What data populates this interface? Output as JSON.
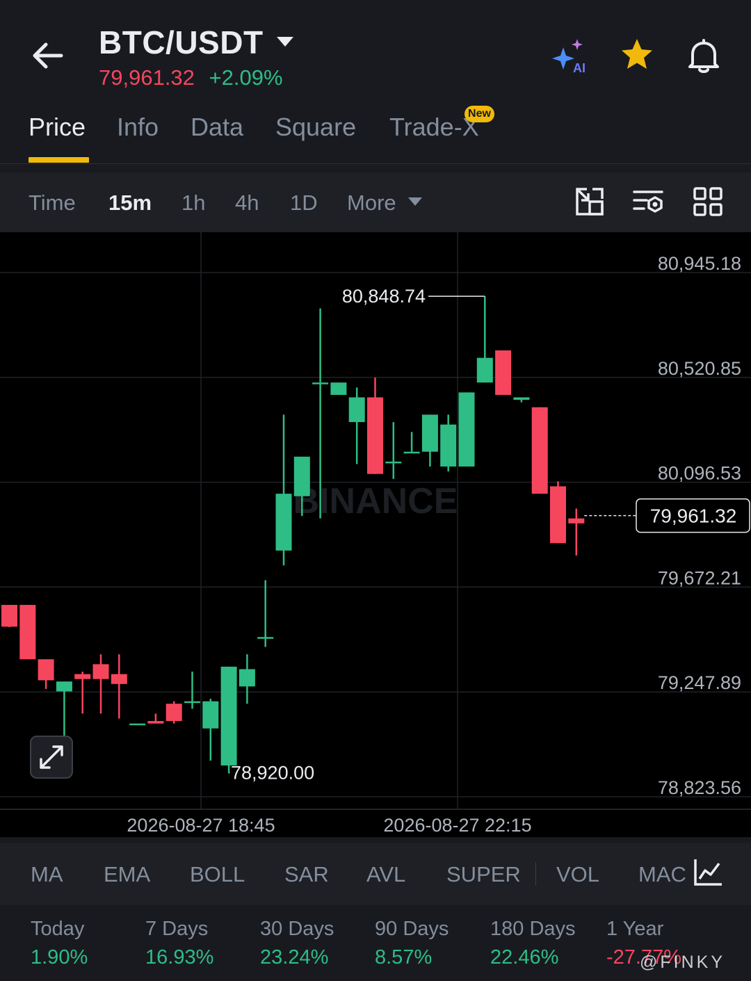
{
  "header": {
    "pair": "BTC/USDT",
    "last_price": "79,961.32",
    "change_pct": "+2.09%",
    "ai_label": "AI",
    "colors": {
      "up": "#2ebd85",
      "down": "#f6465d",
      "accent": "#f0b90b"
    }
  },
  "tabs": [
    {
      "label": "Price",
      "active": true
    },
    {
      "label": "Info",
      "active": false
    },
    {
      "label": "Data",
      "active": false
    },
    {
      "label": "Square",
      "active": false
    },
    {
      "label": "Trade-X",
      "active": false,
      "badge": "New"
    }
  ],
  "intervals": {
    "items": [
      "Time",
      "15m",
      "1h",
      "4h",
      "1D",
      "More"
    ],
    "active": "15m"
  },
  "chart_data": {
    "type": "candlestick",
    "interval": "15m",
    "watermark": "BINANCE",
    "y_ticks": [
      "80,945.18",
      "80,520.85",
      "80,096.53",
      "79,672.21",
      "79,247.89",
      "78,823.56"
    ],
    "x_ticks": [
      "2026-08-27 18:45",
      "2026-08-27 22:15"
    ],
    "current_price_label": "79,961.32",
    "high_label": "80,848.74",
    "low_label": "78,920.00",
    "candles": [
      {
        "o": 79600,
        "h": 79600,
        "l": 79510,
        "c": 79512
      },
      {
        "o": 79600,
        "h": 79600,
        "l": 79380,
        "c": 79380
      },
      {
        "o": 79380,
        "h": 79380,
        "l": 79260,
        "c": 79295
      },
      {
        "o": 79250,
        "h": 79290,
        "l": 79000,
        "c": 79290
      },
      {
        "o": 79320,
        "h": 79330,
        "l": 79160,
        "c": 79300
      },
      {
        "o": 79360,
        "h": 79400,
        "l": 79160,
        "c": 79300
      },
      {
        "o": 79320,
        "h": 79400,
        "l": 79140,
        "c": 79280
      },
      {
        "o": 79120,
        "h": 79120,
        "l": 79120,
        "c": 79120
      },
      {
        "o": 79130,
        "h": 79160,
        "l": 79120,
        "c": 79120
      },
      {
        "o": 79200,
        "h": 79210,
        "l": 79120,
        "c": 79130
      },
      {
        "o": 79210,
        "h": 79330,
        "l": 79180,
        "c": 79210
      },
      {
        "o": 79100,
        "h": 79220,
        "l": 78970,
        "c": 79210
      },
      {
        "o": 78950,
        "h": 79350,
        "l": 78920,
        "c": 79350
      },
      {
        "o": 79270,
        "h": 79400,
        "l": 79200,
        "c": 79340
      },
      {
        "o": 79470,
        "h": 79700,
        "l": 79430,
        "c": 79470
      },
      {
        "o": 79820,
        "h": 80370,
        "l": 79760,
        "c": 80050
      },
      {
        "o": 80040,
        "h": 80200,
        "l": 79960,
        "c": 80200
      },
      {
        "o": 80500,
        "h": 80800,
        "l": 79950,
        "c": 80500
      },
      {
        "o": 80450,
        "h": 80380,
        "l": 80490,
        "c": 80500
      },
      {
        "o": 80340,
        "h": 80480,
        "l": 80170,
        "c": 80440
      },
      {
        "o": 80440,
        "h": 80520,
        "l": 80230,
        "c": 80130
      },
      {
        "o": 80180,
        "h": 80340,
        "l": 80110,
        "c": 80180
      },
      {
        "o": 80220,
        "h": 80300,
        "l": 80220,
        "c": 80220
      },
      {
        "o": 80220,
        "h": 80330,
        "l": 80160,
        "c": 80370
      },
      {
        "o": 80160,
        "h": 80370,
        "l": 80140,
        "c": 80330
      },
      {
        "o": 80160,
        "h": 80370,
        "l": 80200,
        "c": 80460
      },
      {
        "o": 80500,
        "h": 80849,
        "l": 80500,
        "c": 80600
      },
      {
        "o": 80630,
        "h": 80630,
        "l": 80550,
        "c": 80450
      },
      {
        "o": 80430,
        "h": 80400,
        "l": 80420,
        "c": 80440
      },
      {
        "o": 80400,
        "h": 80400,
        "l": 80120,
        "c": 80050
      },
      {
        "o": 80080,
        "h": 80100,
        "l": 79950,
        "c": 79850
      },
      {
        "o": 79950,
        "h": 79990,
        "l": 79800,
        "c": 79930
      }
    ]
  },
  "indicators": [
    "MA",
    "EMA",
    "BOLL",
    "SAR",
    "AVL",
    "SUPER",
    "VOL",
    "MAC"
  ],
  "performance": [
    {
      "label": "Today",
      "value": "1.90%",
      "dir": "up"
    },
    {
      "label": "7 Days",
      "value": "16.93%",
      "dir": "up"
    },
    {
      "label": "30 Days",
      "value": "23.24%",
      "dir": "up"
    },
    {
      "label": "90 Days",
      "value": "8.57%",
      "dir": "up"
    },
    {
      "label": "180 Days",
      "value": "22.46%",
      "dir": "up"
    },
    {
      "label": "1 Year",
      "value": "-27.77%",
      "dir": "down"
    }
  ],
  "watermark_text": "@FINKY"
}
